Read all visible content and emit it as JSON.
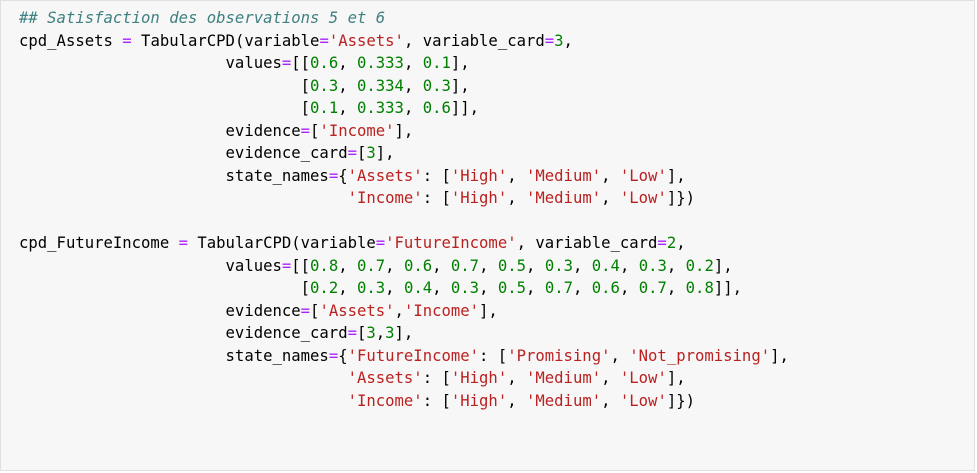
{
  "colors": {
    "background": "#f7f7f7",
    "border": "#e0e0e0",
    "comment": "#408080",
    "operator": "#aa22ff",
    "string": "#ba2121",
    "number": "#008000",
    "text": "#000000"
  },
  "code_lines": [
    [
      {
        "t": "comment",
        "v": "## Satisfaction des observations 5 et 6"
      }
    ],
    [
      {
        "t": "var",
        "v": "cpd_Assets "
      },
      {
        "t": "op",
        "v": "="
      },
      {
        "t": "p",
        "v": " TabularCPD(variable"
      },
      {
        "t": "op",
        "v": "="
      },
      {
        "t": "str",
        "v": "'Assets'"
      },
      {
        "t": "p",
        "v": ", variable_card"
      },
      {
        "t": "op",
        "v": "="
      },
      {
        "t": "num",
        "v": "3"
      },
      {
        "t": "p",
        "v": ","
      }
    ],
    [
      {
        "t": "p",
        "v": "                      values"
      },
      {
        "t": "op",
        "v": "="
      },
      {
        "t": "p",
        "v": "[["
      },
      {
        "t": "num",
        "v": "0.6"
      },
      {
        "t": "p",
        "v": ", "
      },
      {
        "t": "num",
        "v": "0.333"
      },
      {
        "t": "p",
        "v": ", "
      },
      {
        "t": "num",
        "v": "0.1"
      },
      {
        "t": "p",
        "v": "],"
      }
    ],
    [
      {
        "t": "p",
        "v": "                              ["
      },
      {
        "t": "num",
        "v": "0.3"
      },
      {
        "t": "p",
        "v": ", "
      },
      {
        "t": "num",
        "v": "0.334"
      },
      {
        "t": "p",
        "v": ", "
      },
      {
        "t": "num",
        "v": "0.3"
      },
      {
        "t": "p",
        "v": "],"
      }
    ],
    [
      {
        "t": "p",
        "v": "                              ["
      },
      {
        "t": "num",
        "v": "0.1"
      },
      {
        "t": "p",
        "v": ", "
      },
      {
        "t": "num",
        "v": "0.333"
      },
      {
        "t": "p",
        "v": ", "
      },
      {
        "t": "num",
        "v": "0.6"
      },
      {
        "t": "p",
        "v": "]],"
      }
    ],
    [
      {
        "t": "p",
        "v": "                      evidence"
      },
      {
        "t": "op",
        "v": "="
      },
      {
        "t": "p",
        "v": "["
      },
      {
        "t": "str",
        "v": "'Income'"
      },
      {
        "t": "p",
        "v": "],"
      }
    ],
    [
      {
        "t": "p",
        "v": "                      evidence_card"
      },
      {
        "t": "op",
        "v": "="
      },
      {
        "t": "p",
        "v": "["
      },
      {
        "t": "num",
        "v": "3"
      },
      {
        "t": "p",
        "v": "],"
      }
    ],
    [
      {
        "t": "p",
        "v": "                      state_names"
      },
      {
        "t": "op",
        "v": "="
      },
      {
        "t": "p",
        "v": "{"
      },
      {
        "t": "str",
        "v": "'Assets'"
      },
      {
        "t": "p",
        "v": ": ["
      },
      {
        "t": "str",
        "v": "'High'"
      },
      {
        "t": "p",
        "v": ", "
      },
      {
        "t": "str",
        "v": "'Medium'"
      },
      {
        "t": "p",
        "v": ", "
      },
      {
        "t": "str",
        "v": "'Low'"
      },
      {
        "t": "p",
        "v": "],"
      }
    ],
    [
      {
        "t": "p",
        "v": "                                   "
      },
      {
        "t": "str",
        "v": "'Income'"
      },
      {
        "t": "p",
        "v": ": ["
      },
      {
        "t": "str",
        "v": "'High'"
      },
      {
        "t": "p",
        "v": ", "
      },
      {
        "t": "str",
        "v": "'Medium'"
      },
      {
        "t": "p",
        "v": ", "
      },
      {
        "t": "str",
        "v": "'Low'"
      },
      {
        "t": "p",
        "v": "]})"
      }
    ],
    [
      {
        "t": "p",
        "v": ""
      }
    ],
    [
      {
        "t": "var",
        "v": "cpd_FutureIncome "
      },
      {
        "t": "op",
        "v": "="
      },
      {
        "t": "p",
        "v": " TabularCPD(variable"
      },
      {
        "t": "op",
        "v": "="
      },
      {
        "t": "str",
        "v": "'FutureIncome'"
      },
      {
        "t": "p",
        "v": ", variable_card"
      },
      {
        "t": "op",
        "v": "="
      },
      {
        "t": "num",
        "v": "2"
      },
      {
        "t": "p",
        "v": ","
      }
    ],
    [
      {
        "t": "p",
        "v": "                      values"
      },
      {
        "t": "op",
        "v": "="
      },
      {
        "t": "p",
        "v": "[["
      },
      {
        "t": "num",
        "v": "0.8"
      },
      {
        "t": "p",
        "v": ", "
      },
      {
        "t": "num",
        "v": "0.7"
      },
      {
        "t": "p",
        "v": ", "
      },
      {
        "t": "num",
        "v": "0.6"
      },
      {
        "t": "p",
        "v": ", "
      },
      {
        "t": "num",
        "v": "0.7"
      },
      {
        "t": "p",
        "v": ", "
      },
      {
        "t": "num",
        "v": "0.5"
      },
      {
        "t": "p",
        "v": ", "
      },
      {
        "t": "num",
        "v": "0.3"
      },
      {
        "t": "p",
        "v": ", "
      },
      {
        "t": "num",
        "v": "0.4"
      },
      {
        "t": "p",
        "v": ", "
      },
      {
        "t": "num",
        "v": "0.3"
      },
      {
        "t": "p",
        "v": ", "
      },
      {
        "t": "num",
        "v": "0.2"
      },
      {
        "t": "p",
        "v": "],"
      }
    ],
    [
      {
        "t": "p",
        "v": "                              ["
      },
      {
        "t": "num",
        "v": "0.2"
      },
      {
        "t": "p",
        "v": ", "
      },
      {
        "t": "num",
        "v": "0.3"
      },
      {
        "t": "p",
        "v": ", "
      },
      {
        "t": "num",
        "v": "0.4"
      },
      {
        "t": "p",
        "v": ", "
      },
      {
        "t": "num",
        "v": "0.3"
      },
      {
        "t": "p",
        "v": ", "
      },
      {
        "t": "num",
        "v": "0.5"
      },
      {
        "t": "p",
        "v": ", "
      },
      {
        "t": "num",
        "v": "0.7"
      },
      {
        "t": "p",
        "v": ", "
      },
      {
        "t": "num",
        "v": "0.6"
      },
      {
        "t": "p",
        "v": ", "
      },
      {
        "t": "num",
        "v": "0.7"
      },
      {
        "t": "p",
        "v": ", "
      },
      {
        "t": "num",
        "v": "0.8"
      },
      {
        "t": "p",
        "v": "]],"
      }
    ],
    [
      {
        "t": "p",
        "v": "                      evidence"
      },
      {
        "t": "op",
        "v": "="
      },
      {
        "t": "p",
        "v": "["
      },
      {
        "t": "str",
        "v": "'Assets'"
      },
      {
        "t": "p",
        "v": ","
      },
      {
        "t": "str",
        "v": "'Income'"
      },
      {
        "t": "p",
        "v": "],"
      }
    ],
    [
      {
        "t": "p",
        "v": "                      evidence_card"
      },
      {
        "t": "op",
        "v": "="
      },
      {
        "t": "p",
        "v": "["
      },
      {
        "t": "num",
        "v": "3"
      },
      {
        "t": "p",
        "v": ","
      },
      {
        "t": "num",
        "v": "3"
      },
      {
        "t": "p",
        "v": "],"
      }
    ],
    [
      {
        "t": "p",
        "v": "                      state_names"
      },
      {
        "t": "op",
        "v": "="
      },
      {
        "t": "p",
        "v": "{"
      },
      {
        "t": "str",
        "v": "'FutureIncome'"
      },
      {
        "t": "p",
        "v": ": ["
      },
      {
        "t": "str",
        "v": "'Promising'"
      },
      {
        "t": "p",
        "v": ", "
      },
      {
        "t": "str",
        "v": "'Not_promising'"
      },
      {
        "t": "p",
        "v": "],"
      }
    ],
    [
      {
        "t": "p",
        "v": "                                   "
      },
      {
        "t": "str",
        "v": "'Assets'"
      },
      {
        "t": "p",
        "v": ": ["
      },
      {
        "t": "str",
        "v": "'High'"
      },
      {
        "t": "p",
        "v": ", "
      },
      {
        "t": "str",
        "v": "'Medium'"
      },
      {
        "t": "p",
        "v": ", "
      },
      {
        "t": "str",
        "v": "'Low'"
      },
      {
        "t": "p",
        "v": "],"
      }
    ],
    [
      {
        "t": "p",
        "v": "                                   "
      },
      {
        "t": "str",
        "v": "'Income'"
      },
      {
        "t": "p",
        "v": ": ["
      },
      {
        "t": "str",
        "v": "'High'"
      },
      {
        "t": "p",
        "v": ", "
      },
      {
        "t": "str",
        "v": "'Medium'"
      },
      {
        "t": "p",
        "v": ", "
      },
      {
        "t": "str",
        "v": "'Low'"
      },
      {
        "t": "p",
        "v": "]})"
      }
    ]
  ]
}
